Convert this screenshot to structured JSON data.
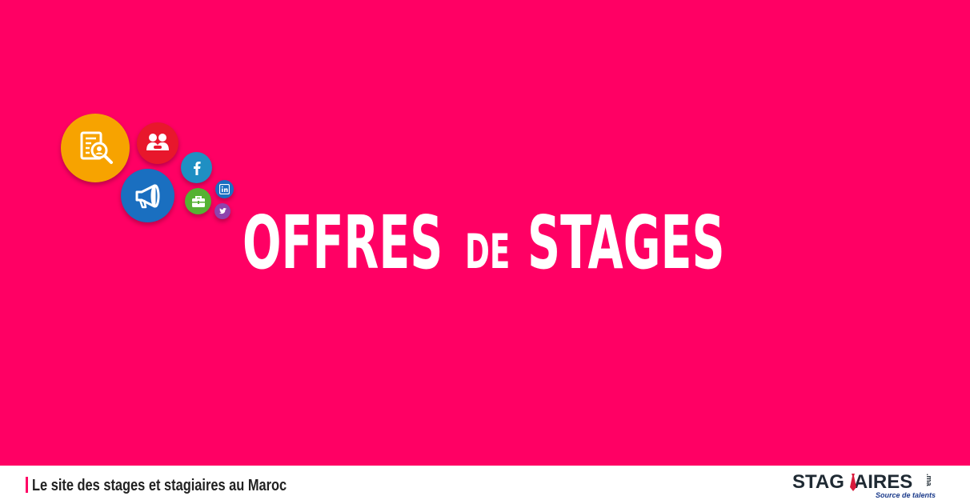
{
  "headline": {
    "word1": "OFFRES",
    "word2": "DE",
    "word3": "STAGES"
  },
  "footer": {
    "tagline": "Le site des stages et stagiaires au Maroc"
  },
  "logo": {
    "wordmark_left": "STAG",
    "wordmark_right": "AIRES",
    "tld": ".ma",
    "subtitle": "Source de talents"
  },
  "icons": [
    {
      "name": "document-search-icon",
      "color": "#f7a300"
    },
    {
      "name": "handshake-icon",
      "color": "#e8172c"
    },
    {
      "name": "facebook-icon",
      "color": "#1f8fc3"
    },
    {
      "name": "megaphone-icon",
      "color": "#1a6fc0"
    },
    {
      "name": "briefcase-icon",
      "color": "#55b233"
    },
    {
      "name": "linkedin-icon",
      "color": "#1a6fc0"
    },
    {
      "name": "twitter-icon",
      "color": "#8e44ad"
    }
  ],
  "colors": {
    "background": "#ff0064",
    "footer_background": "#ffffff",
    "headline_text": "#ffffff",
    "tagline_accent": "#ff0064",
    "logo_text": "#1f2a33",
    "logo_tie": "#d81b3c"
  }
}
